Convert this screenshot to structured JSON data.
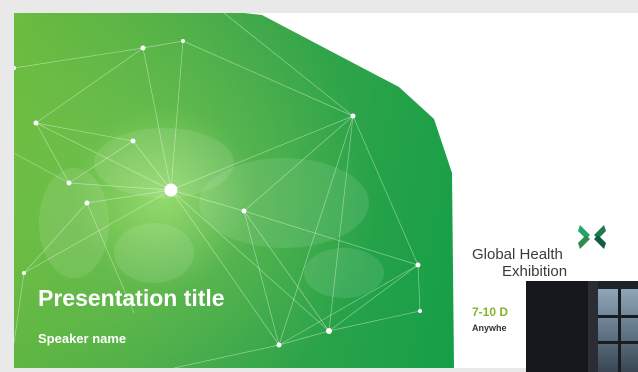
{
  "slide": {
    "title": "Presentation title",
    "speaker": "Speaker name"
  },
  "event": {
    "logo_line1": "Global Health",
    "logo_line2": "Exhibition",
    "date": "7-10 D",
    "location": "Anywhe"
  },
  "colors": {
    "green_dark": "#0e9545",
    "green_light": "#6cbc3f",
    "accent_date": "#82b52a"
  },
  "icons": {
    "logo": "global-health-x-logo-icon",
    "network": "world-network-graphic"
  }
}
